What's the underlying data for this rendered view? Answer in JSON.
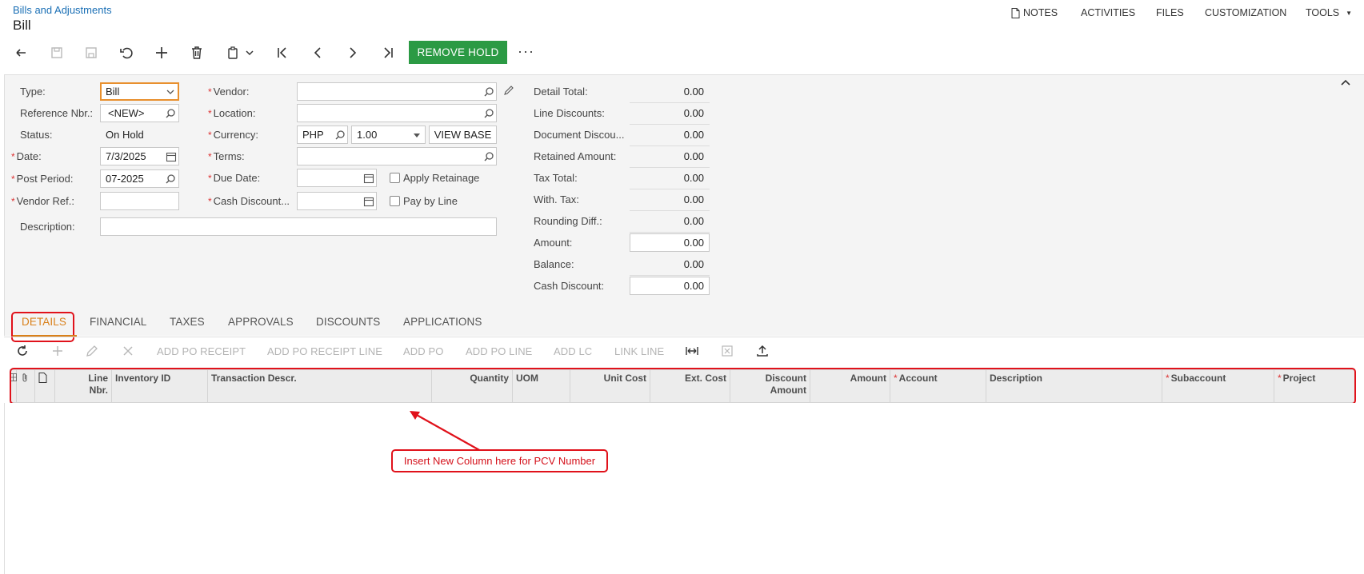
{
  "header": {
    "breadcrumb": "Bills and Adjustments",
    "title": "Bill",
    "nav": {
      "notes": "NOTES",
      "activities": "ACTIVITIES",
      "files": "FILES",
      "customization": "CUSTOMIZATION",
      "tools": "TOOLS"
    }
  },
  "toolbar": {
    "remove_hold": "REMOVE HOLD",
    "more": "···"
  },
  "form": {
    "type": {
      "label": "Type:",
      "value": "Bill"
    },
    "reference_nbr": {
      "label": "Reference Nbr.:",
      "value": "<NEW>"
    },
    "status": {
      "label": "Status:",
      "value": "On Hold"
    },
    "date": {
      "label": "Date:",
      "value": "7/3/2025"
    },
    "post_period": {
      "label": "Post Period:",
      "value": "07-2025"
    },
    "vendor_ref": {
      "label": "Vendor Ref.:",
      "value": ""
    },
    "description": {
      "label": "Description:",
      "value": ""
    },
    "vendor": {
      "label": "Vendor:",
      "value": ""
    },
    "location": {
      "label": "Location:",
      "value": ""
    },
    "currency": {
      "label": "Currency:",
      "value": "PHP",
      "rate": "1.00",
      "view_base": "VIEW BASE"
    },
    "terms": {
      "label": "Terms:",
      "value": ""
    },
    "due_date": {
      "label": "Due Date:",
      "value": ""
    },
    "cash_discount_date": {
      "label": "Cash Discount...",
      "value": ""
    },
    "apply_retainage": {
      "label": "Apply Retainage",
      "checked": false
    },
    "pay_by_line": {
      "label": "Pay by Line",
      "checked": false
    },
    "required_marker": "*"
  },
  "summary": [
    {
      "label": "Detail Total:",
      "value": "0.00",
      "boxed": false
    },
    {
      "label": "Line Discounts:",
      "value": "0.00",
      "boxed": false
    },
    {
      "label": "Document Discou...",
      "value": "0.00",
      "boxed": false
    },
    {
      "label": "Retained Amount:",
      "value": "0.00",
      "boxed": false
    },
    {
      "label": "Tax Total:",
      "value": "0.00",
      "boxed": false
    },
    {
      "label": "With. Tax:",
      "value": "0.00",
      "boxed": false
    },
    {
      "label": "Rounding Diff.:",
      "value": "0.00",
      "boxed": false
    },
    {
      "label": "Amount:",
      "value": "0.00",
      "boxed": true
    },
    {
      "label": "Balance:",
      "value": "0.00",
      "boxed": false
    },
    {
      "label": "Cash Discount:",
      "value": "0.00",
      "boxed": true
    }
  ],
  "tabs": [
    "DETAILS",
    "FINANCIAL",
    "TAXES",
    "APPROVALS",
    "DISCOUNTS",
    "APPLICATIONS"
  ],
  "grid_toolbar": {
    "add_po_receipt": "ADD PO RECEIPT",
    "add_po_receipt_line": "ADD PO RECEIPT LINE",
    "add_po": "ADD PO",
    "add_po_line": "ADD PO LINE",
    "add_lc": "ADD LC",
    "link_line": "LINK LINE"
  },
  "grid_columns": {
    "line_nbr": [
      "Line",
      "Nbr."
    ],
    "inventory_id": "Inventory ID",
    "transaction_descr": "Transaction Descr.",
    "quantity": "Quantity",
    "uom": "UOM",
    "unit_cost": "Unit Cost",
    "ext_cost": "Ext. Cost",
    "discount_amount": [
      "Discount",
      "Amount"
    ],
    "amount": "Amount",
    "account": "Account",
    "description": "Description",
    "subaccount": "Subaccount",
    "project": "Project"
  },
  "annotation": {
    "note": "Insert New Column here for PCV Number",
    "color": "#e0121b"
  },
  "colors": {
    "accent_orange": "#d9801a",
    "button_green": "#2b9a44",
    "link_blue": "#1a6fb5",
    "required_red": "#dd3333"
  }
}
